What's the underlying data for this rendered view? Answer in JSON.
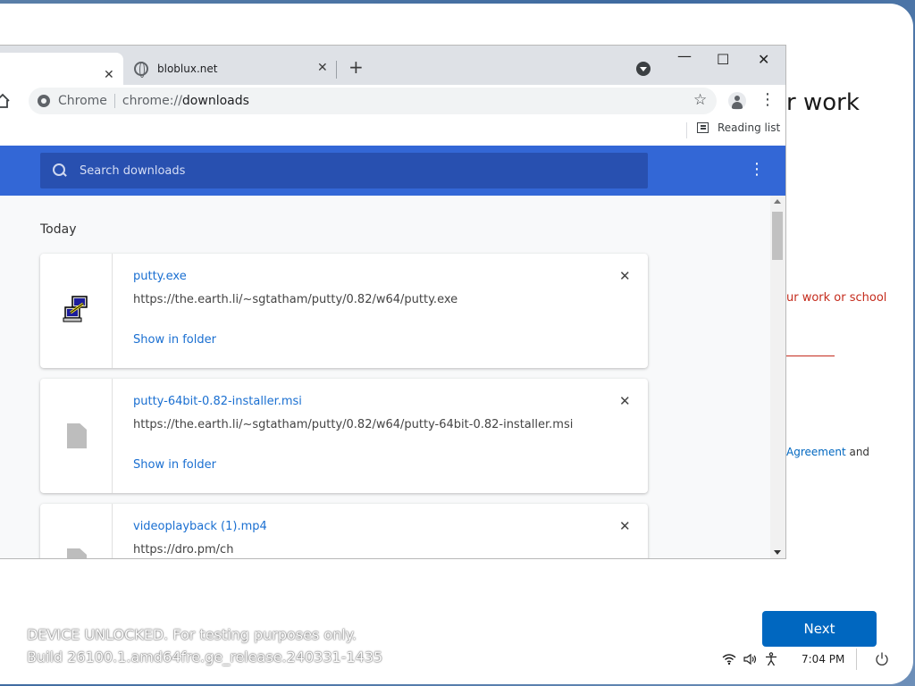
{
  "oobe": {
    "title_fragment": "r work",
    "error_fragment": "ur work or school",
    "terms_link": "Agreement",
    "terms_after": " and",
    "next_label": "Next"
  },
  "watermark": {
    "line1": "DEVICE UNLOCKED. For testing purposes only.",
    "line2": "Build 26100.1.amd64fre.ge_release.240331-1435"
  },
  "taskbar": {
    "time": "7:04 PM",
    "icons": [
      "wifi-icon",
      "volume-icon",
      "accessibility-icon",
      "power-icon"
    ]
  },
  "browser": {
    "tabs": [
      {
        "title": "",
        "active": true,
        "close": "✕"
      },
      {
        "title": "bloblux.net",
        "active": false,
        "close": "✕"
      }
    ],
    "new_tab": "+",
    "window_controls": {
      "minimize": "—",
      "maximize": "☐",
      "close": "✕"
    },
    "omnibox": {
      "site_label": "Chrome",
      "url_scheme": "chrome://",
      "url_path": "downloads"
    },
    "reading_list": "Reading list"
  },
  "downloads": {
    "search_placeholder": "Search downloads",
    "section_label": "Today",
    "items": [
      {
        "name": "putty.exe",
        "url": "https://the.earth.li/~sgtatham/putty/0.82/w64/putty.exe",
        "action": "Show in folder",
        "icon": "putty-icon"
      },
      {
        "name": "putty-64bit-0.82-installer.msi",
        "url": "https://the.earth.li/~sgtatham/putty/0.82/w64/putty-64bit-0.82-installer.msi",
        "action": "Show in folder",
        "icon": "file-icon"
      },
      {
        "name": "videoplayback (1).mp4",
        "url": "https://dro.pm/ch",
        "action": "",
        "icon": "file-icon"
      }
    ]
  },
  "colors": {
    "chrome_header": "#3367d6",
    "link": "#1a6fd1",
    "next_button": "#0067c0",
    "error": "#c42b1c"
  }
}
